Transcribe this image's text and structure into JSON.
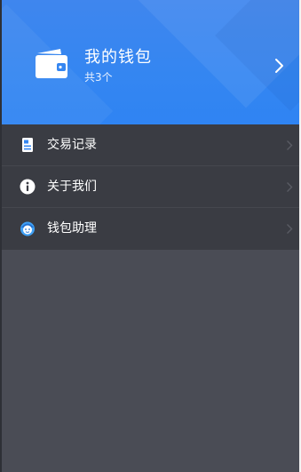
{
  "header": {
    "wallet_title": "我的钱包",
    "wallet_count": "共3个",
    "icons": {
      "wallet": "wallet-icon",
      "chevron": "chevron-right-icon"
    },
    "colors": {
      "accent": "#3586f1"
    }
  },
  "menu": {
    "items": [
      {
        "label": "交易记录",
        "icon": "transaction-record-icon"
      },
      {
        "label": "关于我们",
        "icon": "info-icon"
      },
      {
        "label": "钱包助理",
        "icon": "assistant-icon"
      }
    ]
  },
  "colors": {
    "menu_background": "#3a3c43",
    "page_background": "#4a4c55",
    "text": "#ffffff"
  }
}
